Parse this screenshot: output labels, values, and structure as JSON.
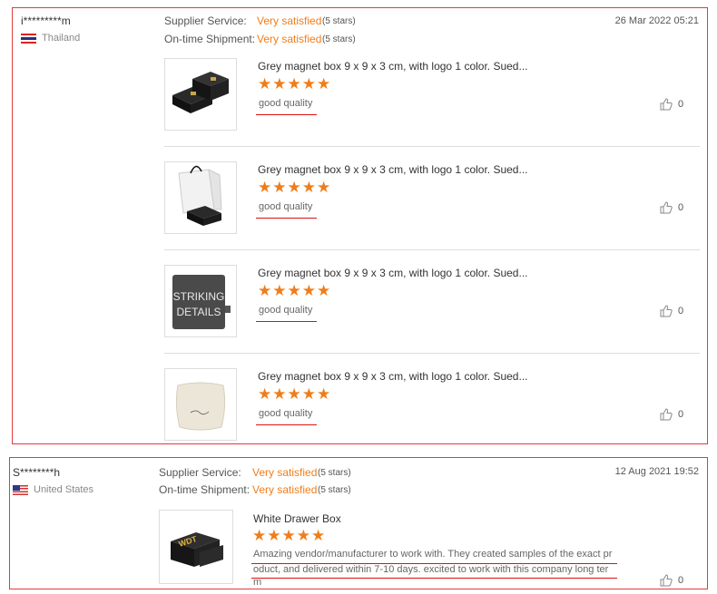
{
  "reviews": [
    {
      "user": "i*********m",
      "country": "Thailand",
      "supplier_label": "Supplier Service:",
      "supplier_value": "Very satisfied",
      "supplier_stars": "(5 stars)",
      "shipment_label": "On-time Shipment:",
      "shipment_value": "Very satisfied",
      "shipment_stars": "(5 stars)",
      "date": "26 Mar 2022 05:21",
      "items": [
        {
          "title": "Grey magnet box 9 x 9 x 3 cm, with logo 1 color. Sued...",
          "stars": "★★★★★",
          "comment": "good quality",
          "likes": "0"
        },
        {
          "title": "Grey magnet box 9 x 9 x 3 cm, with logo 1 color. Sued...",
          "stars": "★★★★★",
          "comment": "good quality",
          "likes": "0"
        },
        {
          "title": "Grey magnet box 9 x 9 x 3 cm, with logo 1 color. Sued...",
          "stars": "★★★★★",
          "comment": "good quality",
          "likes": "0",
          "image_text_line1": "STRIKING",
          "image_text_line2": "DETAILS"
        },
        {
          "title": "Grey magnet box 9 x 9 x 3 cm, with logo 1 color. Sued...",
          "stars": "★★★★★",
          "comment": "good quality",
          "likes": "0"
        }
      ]
    },
    {
      "user": "S********h",
      "country": "United States",
      "supplier_label": "Supplier Service:",
      "supplier_value": "Very satisfied",
      "supplier_stars": "(5 stars)",
      "shipment_label": "On-time Shipment:",
      "shipment_value": "Very satisfied",
      "shipment_stars": "(5 stars)",
      "date": "12 Aug 2021 19:52",
      "items": [
        {
          "title": "White Drawer Box",
          "stars": "★★★★★",
          "comment_line1": "Amazing vendor/manufacturer to work with. They created samples of the exact pr",
          "comment_line2": "oduct, and delivered within 7-10 days. excited to work with this company long ter",
          "comment_line3": "m",
          "likes": "0",
          "image_text": "WDT"
        }
      ]
    }
  ],
  "colors": {
    "accent": "#f07d1a",
    "border": "#e03b3b",
    "underline": "#dd1111"
  }
}
